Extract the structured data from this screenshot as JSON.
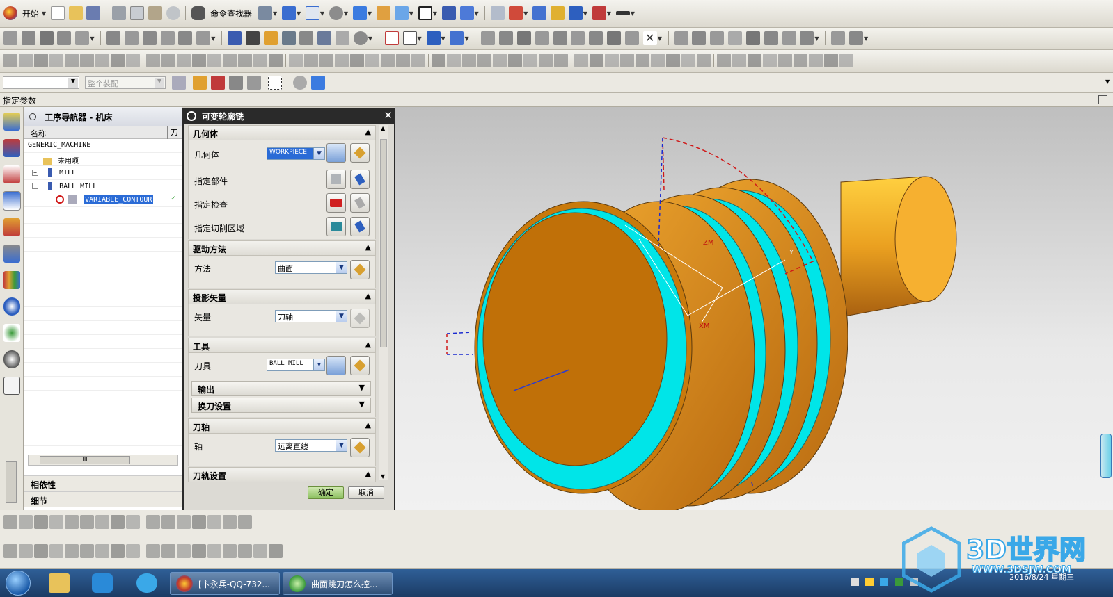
{
  "toolbar": {
    "start_label": "开始",
    "finder_label": "命令查找器"
  },
  "filter_bar": {
    "filter_value": "",
    "assembly_value": "整个装配"
  },
  "status_prompt": "指定参数",
  "navigator": {
    "title": "工序导航器 - 机床",
    "col_name": "名称",
    "col_tool": "刀",
    "rows": [
      {
        "label": "GENERIC_MACHINE",
        "indent": 0
      },
      {
        "label": "未用项",
        "indent": 1
      },
      {
        "label": "MILL",
        "indent": 1
      },
      {
        "label": "BALL_MILL",
        "indent": 1
      },
      {
        "label": "VARIABLE_CONTOUR",
        "indent": 2
      }
    ],
    "scroll_label": "III",
    "panel_dependency": "相依性",
    "panel_details": "细节"
  },
  "dialog": {
    "title": "可变轮廓铣",
    "sec_geometry": "几何体",
    "geometry_label": "几何体",
    "geometry_value": "WORKPIECE",
    "part_label": "指定部件",
    "check_label": "指定检查",
    "cut_area_label": "指定切削区域",
    "sec_drive": "驱动方法",
    "method_label": "方法",
    "method_value": "曲面",
    "sec_proj": "投影矢量",
    "vector_label": "矢量",
    "vector_value": "刀轴",
    "sec_tool": "工具",
    "tool_label": "刀具",
    "tool_value": "BALL_MILL",
    "output_label": "输出",
    "toolchange_label": "换刀设置",
    "sec_axis": "刀轴",
    "axis_label": "轴",
    "axis_value": "远离直线",
    "sec_path": "刀轨设置",
    "ok_label": "确定",
    "cancel_label": "取消"
  },
  "viewport": {
    "axis_labels": [
      "ZM",
      "Y",
      "XM"
    ]
  },
  "taskbar": {
    "tasks": [
      "[卞永兵-QQ-732...",
      "曲面跳刀怎么控..."
    ],
    "date": "2016/8/24 星期三"
  },
  "watermark": {
    "text": "3D世界网",
    "url": "WWW.3DSJW.COM"
  },
  "colors": {
    "part_orange": "#e8940f",
    "face_cyan": "#00e5e8",
    "selection_blue": "#2a6bd6",
    "dialog_title": "#2a2a2a"
  }
}
